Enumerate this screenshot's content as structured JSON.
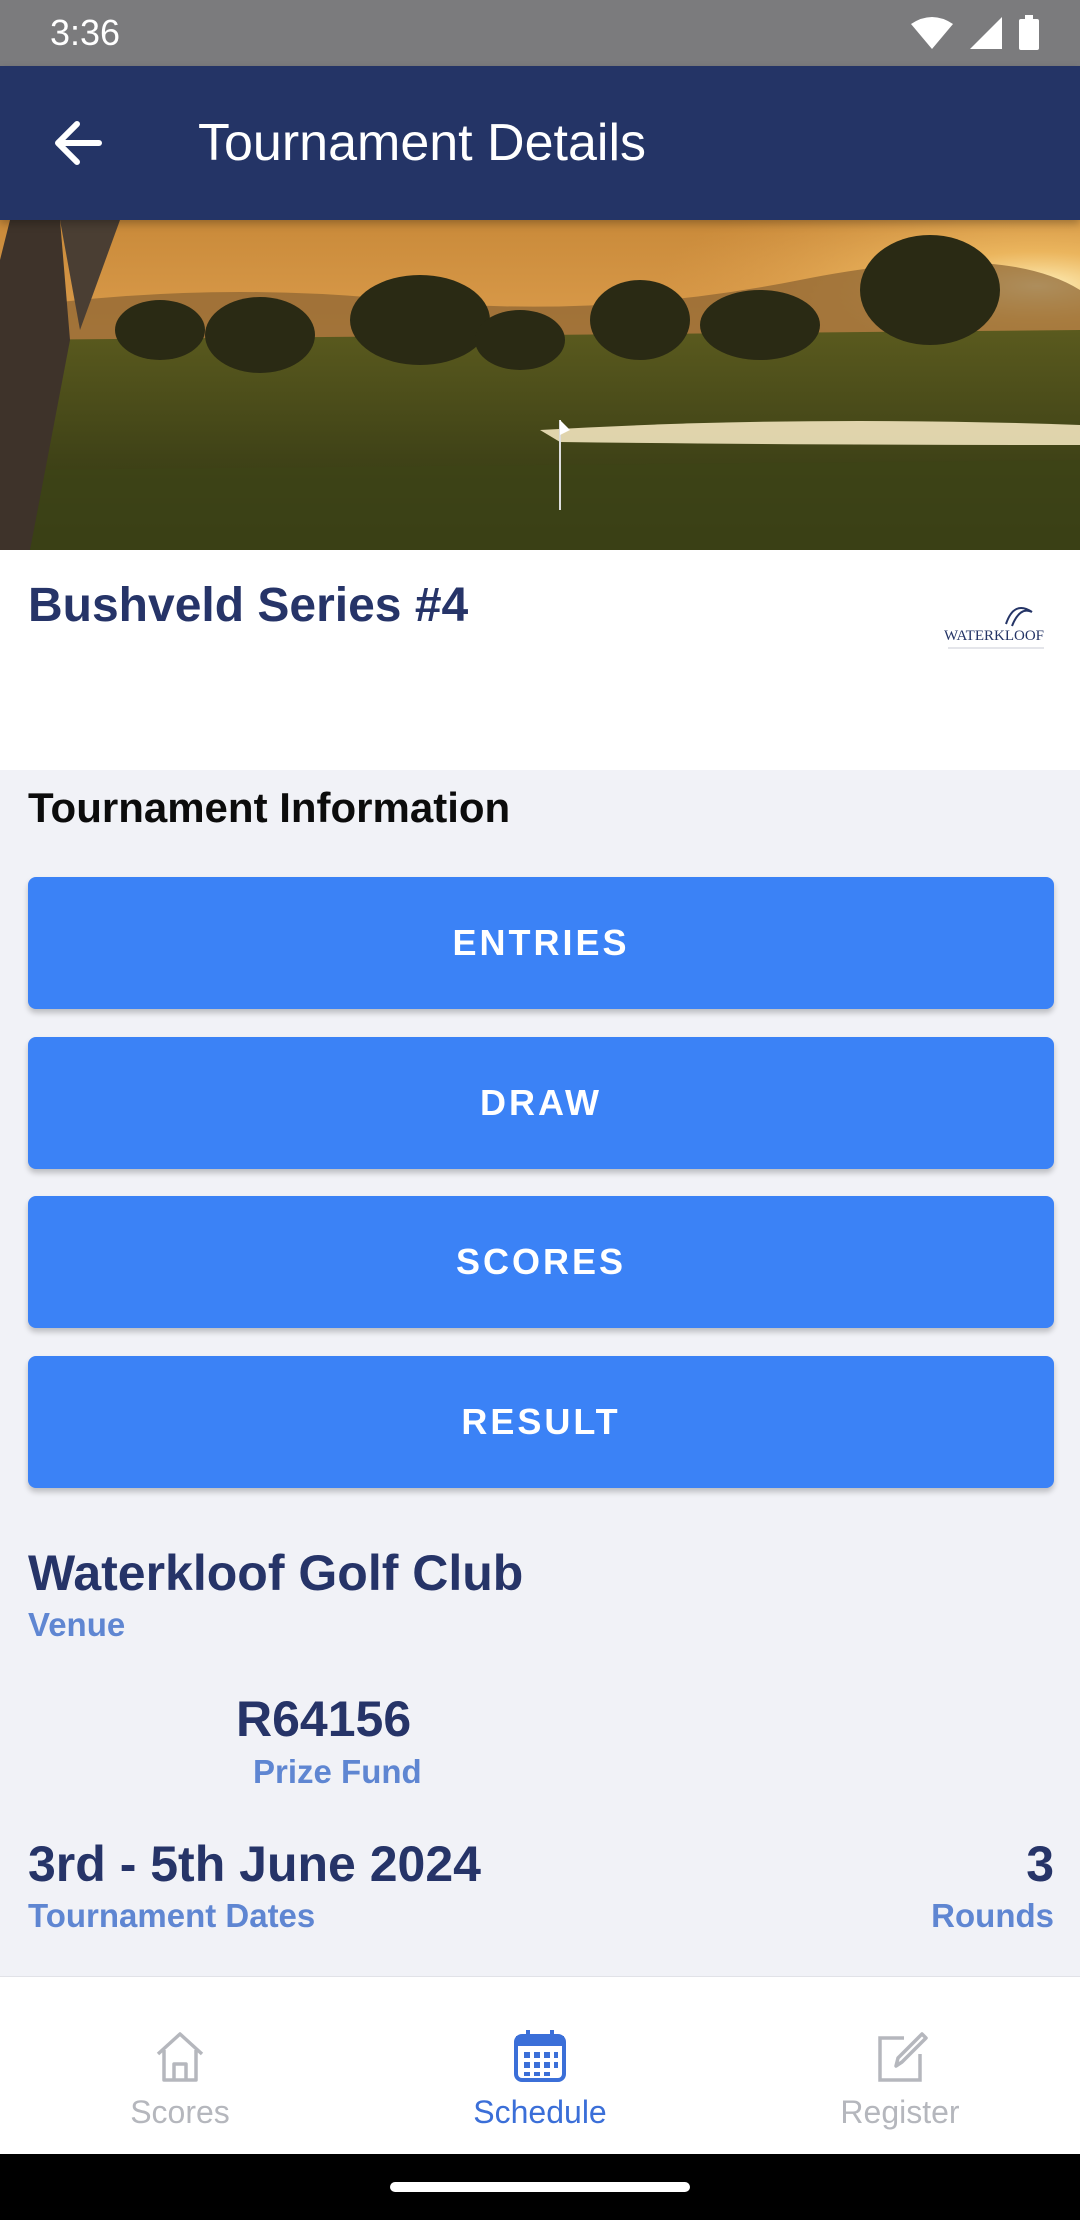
{
  "status_bar": {
    "time": "3:36",
    "icons": [
      "wifi-icon",
      "signal-icon",
      "battery-icon"
    ]
  },
  "app_bar": {
    "title": "Tournament Details",
    "back_icon": "arrow-left-icon"
  },
  "tournament": {
    "name": "Bushveld Series #4",
    "logo_text": "WATERKLOOF"
  },
  "info": {
    "section_title": "Tournament Information",
    "buttons": [
      "ENTRIES",
      "DRAW",
      "SCORES",
      "RESULT"
    ]
  },
  "details": {
    "venue_value": "Waterkloof Golf Club",
    "venue_label": "Venue",
    "prize_value": "R64156",
    "prize_label": "Prize Fund",
    "dates_value": "3rd - 5th June 2024",
    "dates_label": "Tournament Dates",
    "rounds_value": "3",
    "rounds_label": "Rounds"
  },
  "bottom_nav": {
    "items": [
      {
        "label": "Scores",
        "icon": "home-icon",
        "active": false
      },
      {
        "label": "Schedule",
        "icon": "calendar-icon",
        "active": true
      },
      {
        "label": "Register",
        "icon": "edit-icon",
        "active": false
      }
    ]
  },
  "colors": {
    "app_bar": "#243466",
    "accent_button": "#3b82f6",
    "title_text": "#263468",
    "label_text": "#5f86d2",
    "nav_active": "#3b6fd8"
  }
}
